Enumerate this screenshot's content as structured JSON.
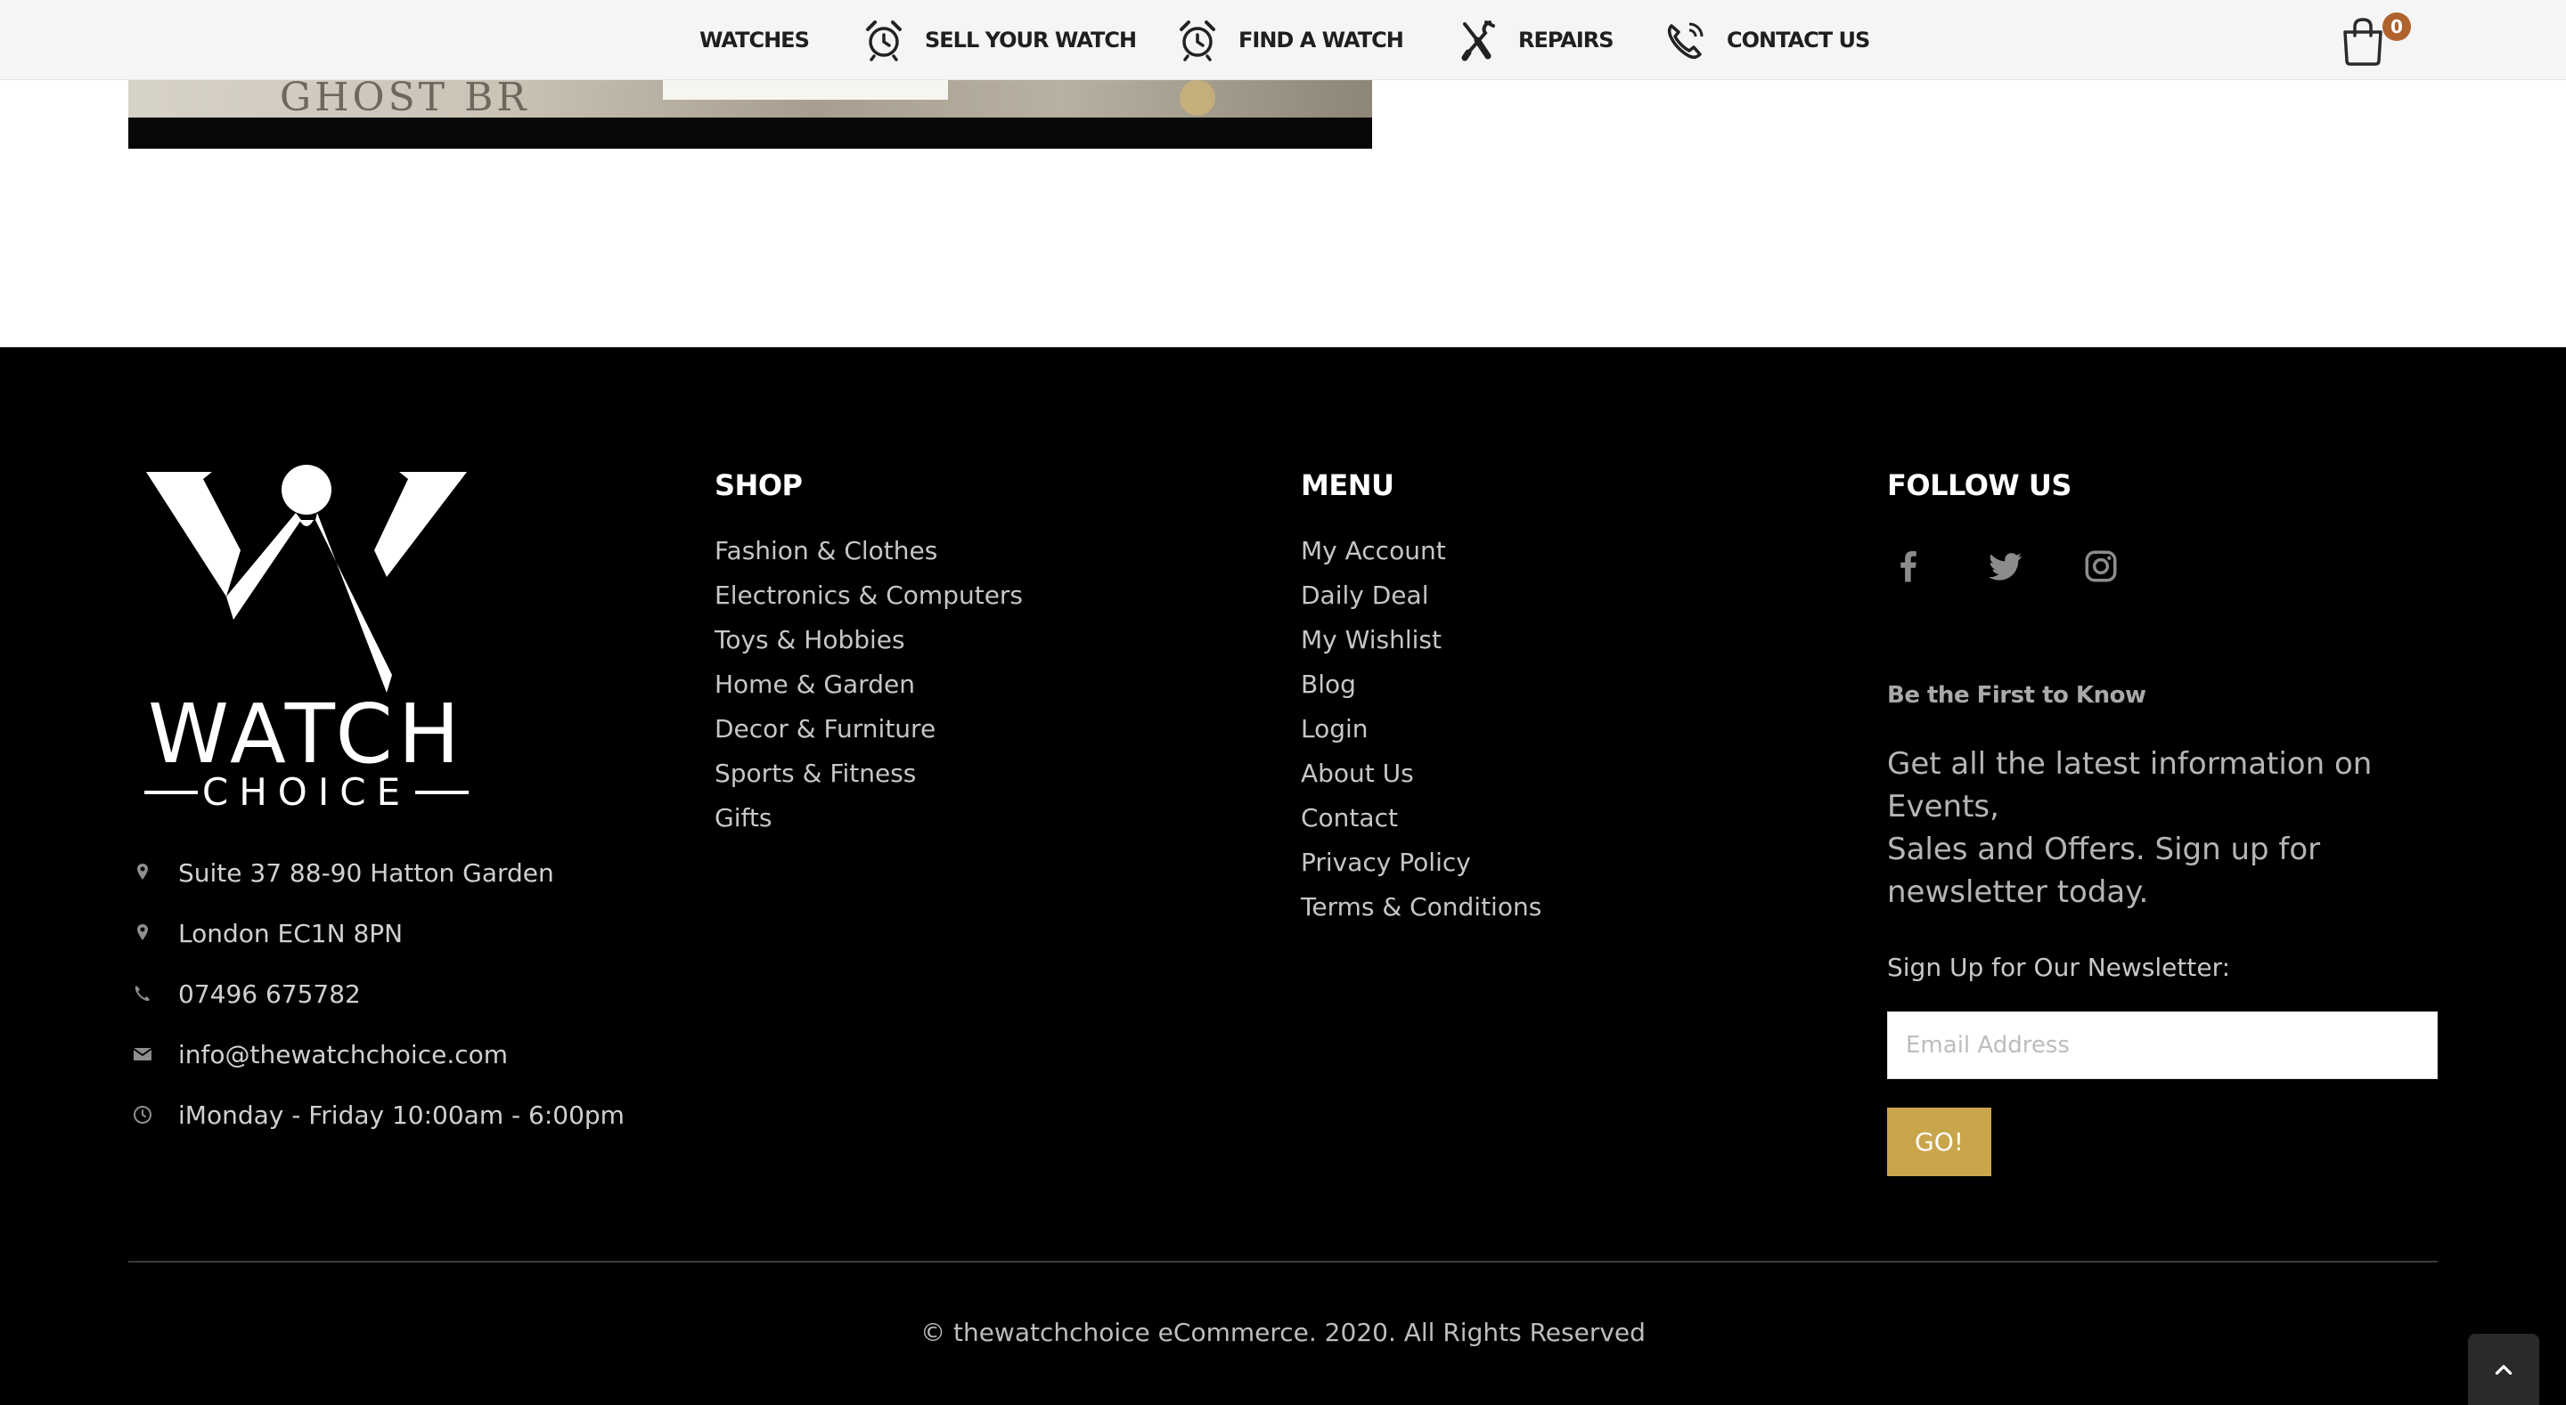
{
  "nav": {
    "items": [
      {
        "label": "WATCHES",
        "icon": ""
      },
      {
        "label": "SELL YOUR WATCH",
        "icon": "alarm-clock-icon"
      },
      {
        "label": "FIND A WATCH",
        "icon": "alarm-clock-icon"
      },
      {
        "label": "REPAIRS",
        "icon": "tools-icon"
      },
      {
        "label": "CONTACT US",
        "icon": "phone-icon"
      }
    ],
    "cart_count": "0"
  },
  "hero": {
    "sign_text": "GHOST BR"
  },
  "footer": {
    "logo": {
      "line1": "WATCH",
      "line2": "CHOICE"
    },
    "contact": [
      {
        "icon": "map-pin-icon",
        "text": "Suite 37 88-90 Hatton Garden"
      },
      {
        "icon": "map-pin-icon",
        "text": "London EC1N 8PN"
      },
      {
        "icon": "phone-icon",
        "text": "07496 675782"
      },
      {
        "icon": "envelope-icon",
        "text": "info@thewatchchoice.com"
      },
      {
        "icon": "clock-icon",
        "text": "iMonday - Friday 10:00am - 6:00pm"
      }
    ],
    "shop": {
      "title": "SHOP",
      "links": [
        "Fashion & Clothes",
        "Electronics & Computers",
        "Toys & Hobbies",
        "Home & Garden",
        "Decor & Furniture",
        "Sports & Fitness",
        "Gifts"
      ]
    },
    "menu": {
      "title": "MENU",
      "links": [
        "My Account",
        "Daily Deal",
        "My Wishlist",
        "Blog",
        "Login",
        "About Us",
        "Contact",
        "Privacy Policy",
        "Terms & Conditions"
      ]
    },
    "follow": {
      "title": "FOLLOW US",
      "socials": [
        "facebook-icon",
        "twitter-icon",
        "instagram-icon"
      ]
    },
    "newsletter": {
      "heading": "Be the First to Know",
      "blurb_line1": "Get all the latest information on Events,",
      "blurb_line2": "Sales and Offers. Sign up for newsletter today.",
      "label": "Sign Up for Our Newsletter:",
      "placeholder": "Email Address",
      "button": "GO!"
    },
    "copyright": "© thewatchchoice eCommerce. 2020. All Rights Reserved"
  },
  "colors": {
    "accent_gold": "#c9a54b",
    "cart_badge": "#b0622d",
    "footer_bg": "#000000",
    "nav_bg": "#f5f5f5"
  }
}
